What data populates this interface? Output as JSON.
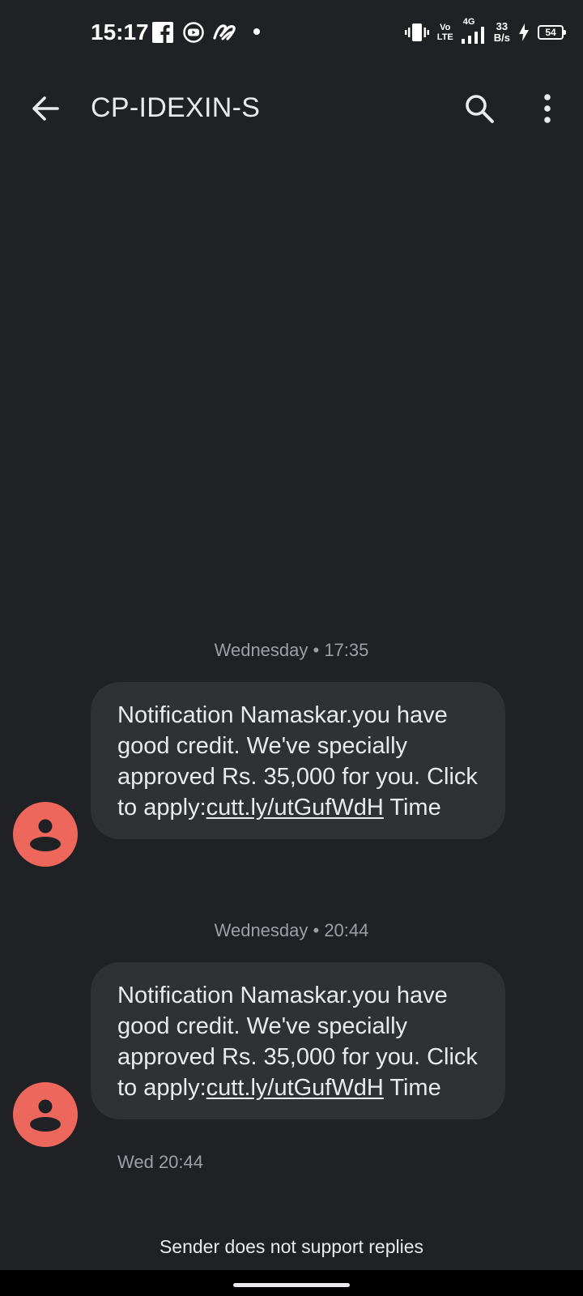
{
  "status_bar": {
    "time": "15:17",
    "icons": [
      "facebook-icon",
      "youtube-icon",
      "app-notification-icon",
      "notification-dot-icon"
    ],
    "network_top": "Vo",
    "network_bottom": "LTE",
    "network_gen": "4G",
    "speed_value": "33",
    "speed_unit": "B/s",
    "battery_level": "54"
  },
  "header": {
    "title": "CP-IDEXIN-S",
    "back_icon": "arrow-back-icon",
    "search_icon": "search-icon",
    "menu_icon": "more-vert-icon"
  },
  "messages": [
    {
      "date_label": "Wednesday • 17:35",
      "text_before": "Notification Namaskar.you have good credit. We've specially approved Rs. 35,000 for you. Click to apply:",
      "link": "cutt.ly/utGufWdH",
      "text_after": " Time"
    },
    {
      "date_label": "Wednesday • 20:44",
      "text_before": "Notification Namaskar.you have good credit. We've specially approved Rs. 35,000 for you. Click to apply:",
      "link": "cutt.ly/utGufWdH",
      "text_after": " Time",
      "timestamp": "Wed 20:44"
    }
  ],
  "footer": {
    "note": "Sender does not support replies"
  },
  "colors": {
    "background": "#202124",
    "bubble": "#303134",
    "avatar": "#ee675c",
    "secondary_text": "#9aa0a6"
  }
}
